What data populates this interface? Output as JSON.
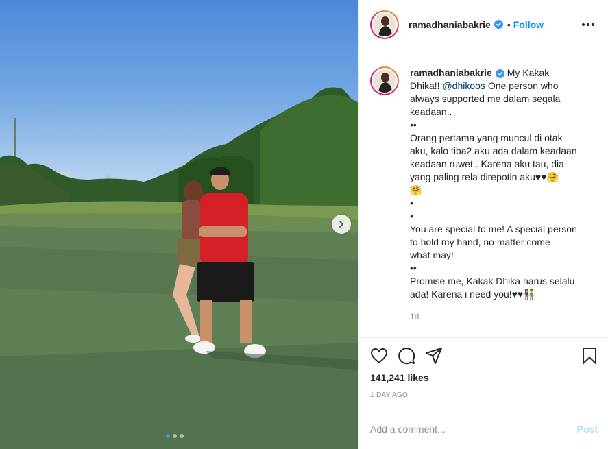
{
  "post": {
    "username": "ramadhaniabakrie",
    "follow_label": "Follow",
    "separator": "•",
    "caption_lines": [
      "My Kakak",
      "Dhika!! ",
      "@dhikoos",
      " One person who",
      "always supported me dalam segala",
      "keadaan..",
      "••",
      "Orang pertama yang muncul di otak",
      "aku, kalo tiba2 aku ada dalam keadaan",
      "keadaan ruwet.. Karena aku tau, dia",
      "yang paling rela direpotin aku♥♥🤗",
      "🤗",
      "•",
      "•",
      "You are special to me! A special person",
      "to hold my hand, no matter come",
      "what may!",
      "••",
      "Promise me, Kakak Dhika harus selalu",
      "ada! Karena i need you!♥♥👫"
    ],
    "time_ago": "1d",
    "likes": "141,241 likes",
    "date": "1 DAY AGO",
    "comment_placeholder": "Add a comment...",
    "post_label": "Post"
  },
  "carousel": {
    "count": 3,
    "active": 0
  },
  "icons": {
    "verified": "verified-badge-icon",
    "more": "more-options-icon",
    "like": "heart-icon",
    "comment": "comment-bubble-icon",
    "share": "paper-plane-icon",
    "save": "bookmark-icon",
    "next": "chevron-right-icon"
  },
  "colors": {
    "accent": "#0095f6",
    "verified": "#3897f0",
    "mention": "#00376b",
    "muted": "#8e8e8e",
    "post_disabled": "#b2dffc"
  }
}
